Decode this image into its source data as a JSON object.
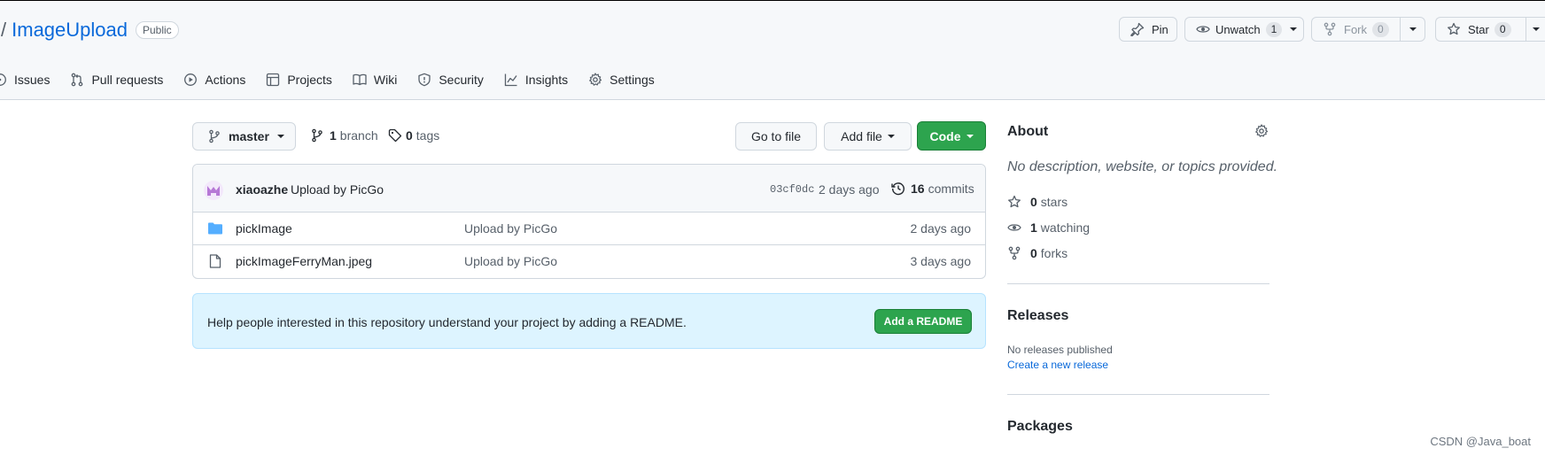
{
  "repo": {
    "slash": "/",
    "name": "ImageUpload",
    "visibility": "Public"
  },
  "header_actions": {
    "pin": "Pin",
    "unwatch": "Unwatch",
    "watch_count": "1",
    "fork": "Fork",
    "fork_count": "0",
    "star": "Star",
    "star_count": "0"
  },
  "tabs": [
    {
      "label": "Issues",
      "icon": "issue-icon"
    },
    {
      "label": "Pull requests",
      "icon": "pull-request-icon"
    },
    {
      "label": "Actions",
      "icon": "play-icon"
    },
    {
      "label": "Projects",
      "icon": "table-icon"
    },
    {
      "label": "Wiki",
      "icon": "book-icon"
    },
    {
      "label": "Security",
      "icon": "shield-icon"
    },
    {
      "label": "Insights",
      "icon": "graph-icon"
    },
    {
      "label": "Settings",
      "icon": "gear-icon"
    }
  ],
  "branch": {
    "current": "master",
    "branch_count": "1",
    "branch_label": "branch",
    "tag_count": "0",
    "tag_label": "tags"
  },
  "toolbar": {
    "go_to_file": "Go to file",
    "add_file": "Add file",
    "code": "Code"
  },
  "latest_commit": {
    "author": "xiaoazhe",
    "message": "Upload by PicGo",
    "sha": "03cf0dc",
    "time": "2 days ago",
    "commit_count": "16",
    "commit_label": "commits"
  },
  "files": [
    {
      "type": "folder",
      "name": "pickImage",
      "message": "Upload by PicGo",
      "time": "2 days ago"
    },
    {
      "type": "file",
      "name": "pickImageFerryMan.jpeg",
      "message": "Upload by PicGo",
      "time": "3 days ago"
    }
  ],
  "readme_prompt": {
    "text": "Help people interested in this repository understand your project by adding a README.",
    "button": "Add a README"
  },
  "about": {
    "title": "About",
    "description": "No description, website, or topics provided.",
    "stars_count": "0",
    "stars_label": "stars",
    "watching_count": "1",
    "watching_label": "watching",
    "forks_count": "0",
    "forks_label": "forks"
  },
  "releases": {
    "title": "Releases",
    "none_text": "No releases published",
    "create_link": "Create a new release"
  },
  "packages": {
    "title": "Packages"
  },
  "watermark": "CSDN @Java_boat",
  "colors": {
    "link": "#0969da",
    "primary_button": "#2da44e",
    "readme_background": "#ddf4ff",
    "header_background": "#f6f8fa"
  }
}
